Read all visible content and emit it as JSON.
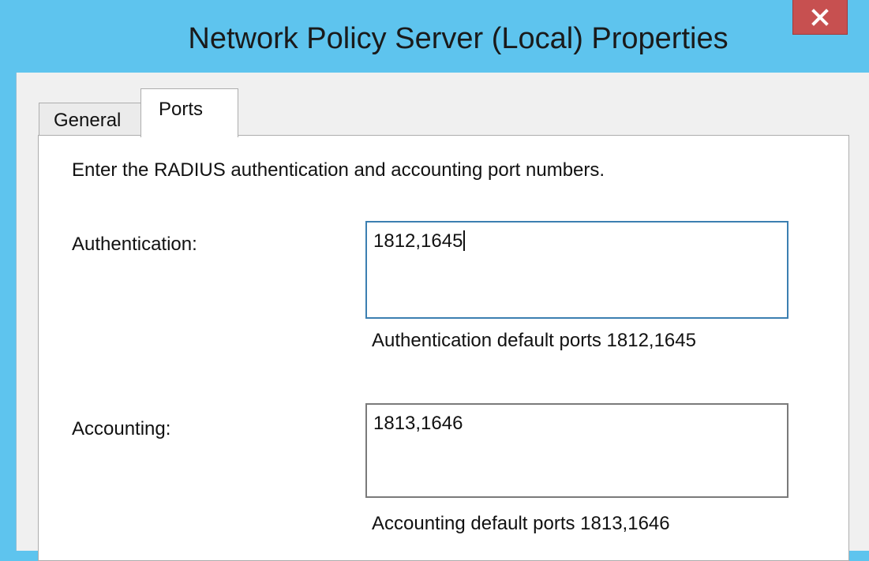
{
  "window": {
    "title": "Network Policy Server (Local) Properties",
    "close_glyph": "x"
  },
  "tabs": [
    {
      "label": "General",
      "active": false
    },
    {
      "label": "Ports",
      "active": true
    }
  ],
  "ports_panel": {
    "instruction": "Enter the RADIUS authentication and accounting port numbers.",
    "authentication": {
      "label": "Authentication:",
      "value": "1812,1645",
      "hint": "Authentication default ports 1812,1645"
    },
    "accounting": {
      "label": "Accounting:",
      "value": "1813,1646",
      "hint": "Accounting default ports 1813,1646"
    }
  },
  "colors": {
    "titlebar": "#5ec4ee",
    "close_button": "#c75050",
    "focus_border": "#3c7fb1"
  }
}
